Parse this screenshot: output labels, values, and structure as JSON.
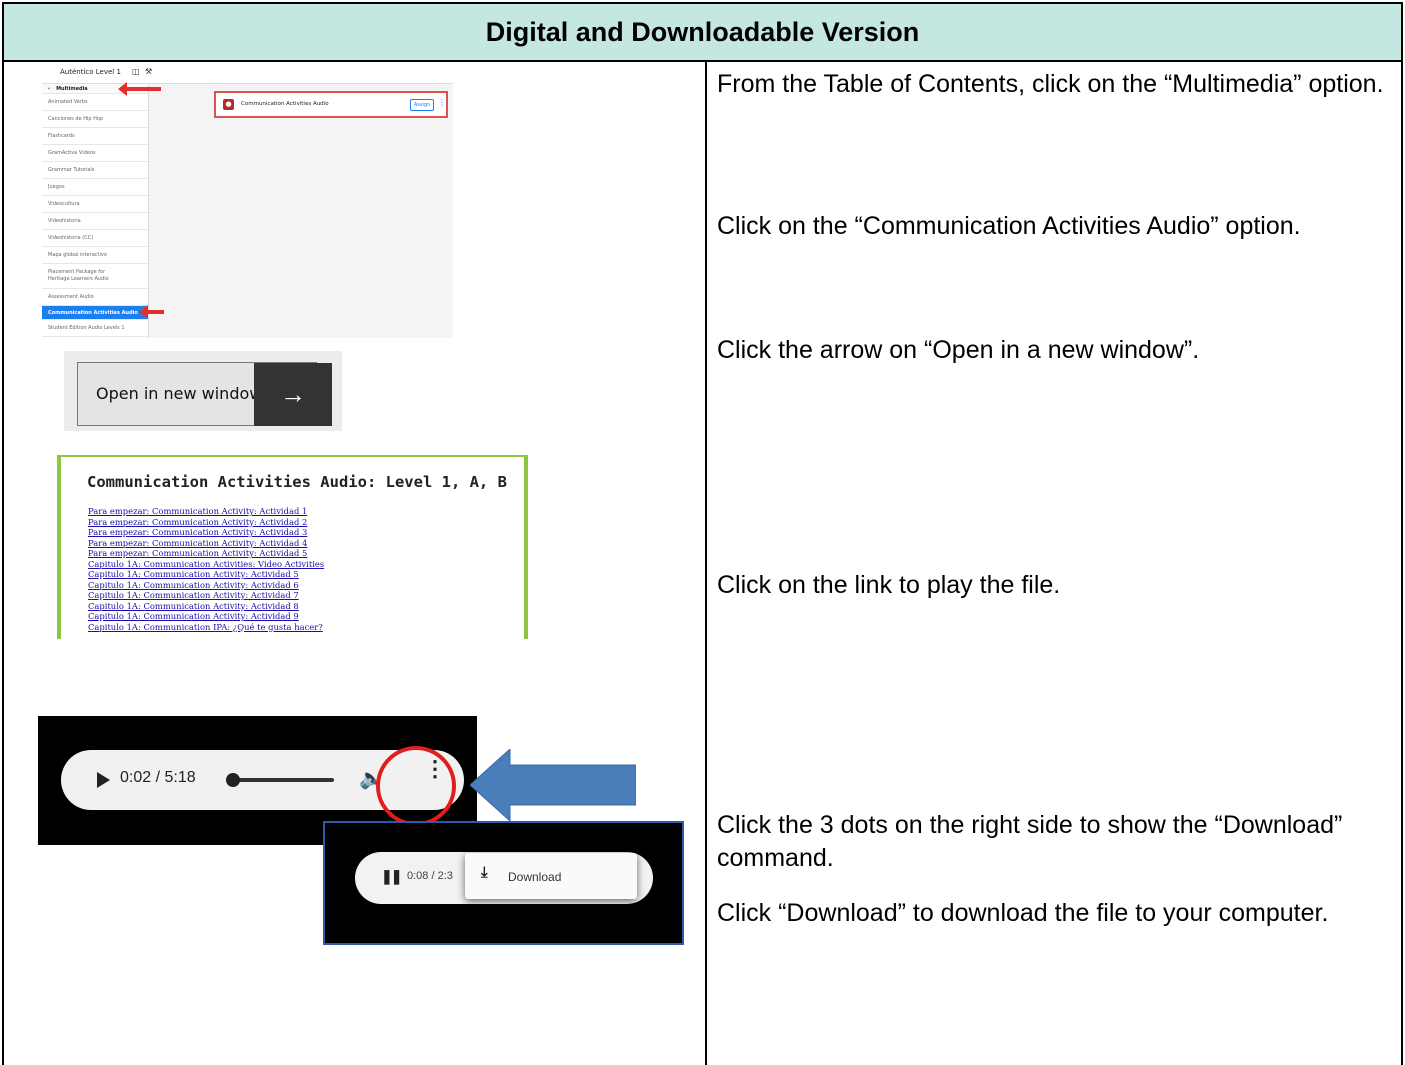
{
  "header": {
    "title": "Digital and Downloadable Version"
  },
  "instructions": [
    "From the Table of Contents, click on the “Multimedia” option.",
    "Click on the “Communication Activities Audio” option.",
    "Click the arrow on “Open in a new window”.",
    "Click on the link to play the file.",
    "Click the 3 dots on the right side to show the “Download” command.",
    "Click “Download” to download the file to your computer."
  ],
  "screenshot1": {
    "app_title": "Auténtico Level 1",
    "menu_header": "Multimedia",
    "menu_items": [
      "Animated Verbs",
      "Canciones de Hip Hop",
      "Flashcards",
      "GramActiva Videos",
      "Grammar Tutorials",
      "Juegos",
      "Videocultura",
      "Videohistoria",
      "Videohistoria (CC)",
      "Mapa global interactivo",
      "Placement Package for Heritage Learners Audio",
      "Assessment Audio",
      "Communication Activities Audio",
      "Student Edition Audio Levels 1"
    ],
    "card_title": "Communication Activities Audio",
    "assign_label": "Assign"
  },
  "open_window": {
    "label": "Open in new window",
    "arrow": "→"
  },
  "links_page": {
    "title": "Communication Activities Audio: Level 1, A, B",
    "links": [
      "Para empezar: Communication Activity: Actividad 1",
      "Para empezar: Communication Activity: Actividad 2",
      "Para empezar: Communication Activity: Actividad 3",
      "Para empezar: Communication Activity: Actividad 4",
      "Para empezar: Communication Activity: Actividad 5",
      "Capitulo 1A: Communication Activities: Video Activities",
      "Capitulo 1A: Communication Activity: Actividad 5",
      "Capitulo 1A: Communication Activity: Actividad 6",
      "Capitulo 1A: Communication Activity: Actividad 7",
      "Capitulo 1A: Communication Activity: Actividad 8",
      "Capitulo 1A: Communication Activity: Actividad 9",
      "Capitulo 1A: Communication IPA: ¿Qué te gusta hacer?"
    ]
  },
  "player1": {
    "time": "0:02 / 5:18"
  },
  "player2": {
    "time": "0:08 / 2:3",
    "download_label": "Download"
  },
  "colors": {
    "header_bg": "#c5e7e2",
    "highlight": "#e11d1d",
    "arrow_blue": "#4a7ebb",
    "link": "#1a0dab",
    "accent_green": "#8dc63f"
  }
}
